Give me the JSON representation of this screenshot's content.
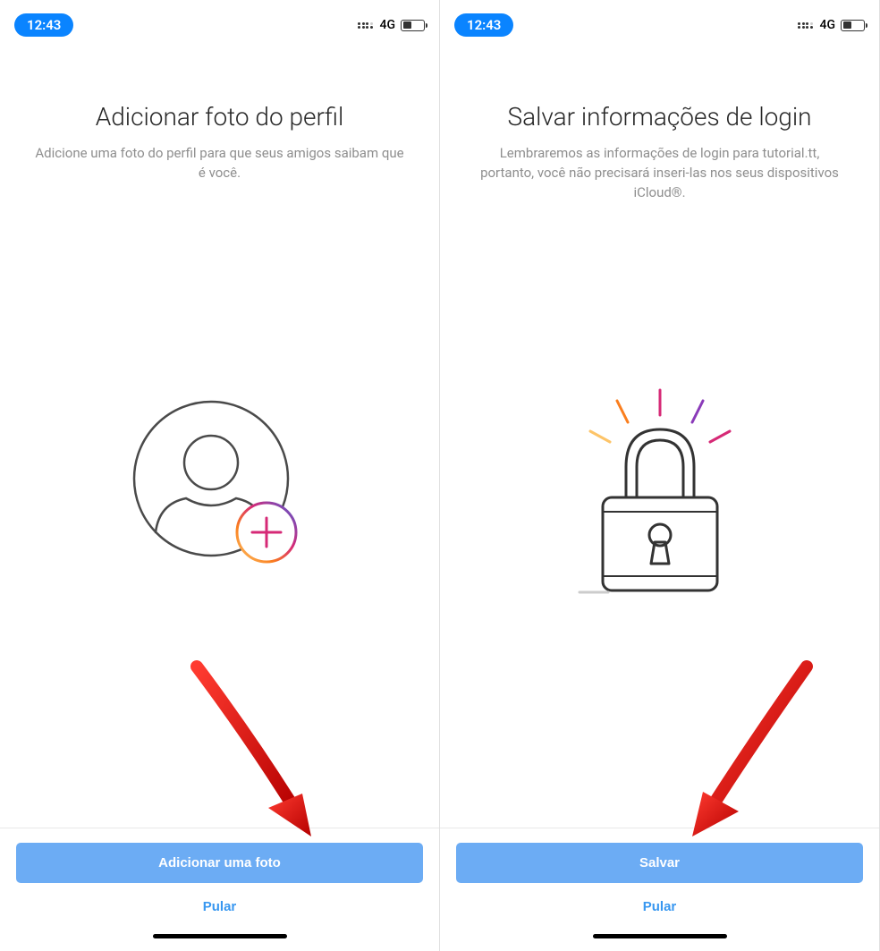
{
  "status": {
    "time": "12:43",
    "network": "4G"
  },
  "screens": {
    "left": {
      "title": "Adicionar foto do perfil",
      "subtitle": "Adicione uma foto do perfil para que seus amigos saibam que é você.",
      "primary_button": "Adicionar uma foto",
      "skip_button": "Pular"
    },
    "right": {
      "title": "Salvar informações de login",
      "subtitle": "Lembraremos as informações de login para tutorial.tt, portanto, você não precisará inseri-las nos seus dispositivos iCloud®.",
      "primary_button": "Salvar",
      "skip_button": "Pular"
    }
  },
  "colors": {
    "primary_button": "#6cacf4",
    "link": "#3897f0",
    "time_pill": "#0a84ff",
    "arrow": "#e30000"
  }
}
